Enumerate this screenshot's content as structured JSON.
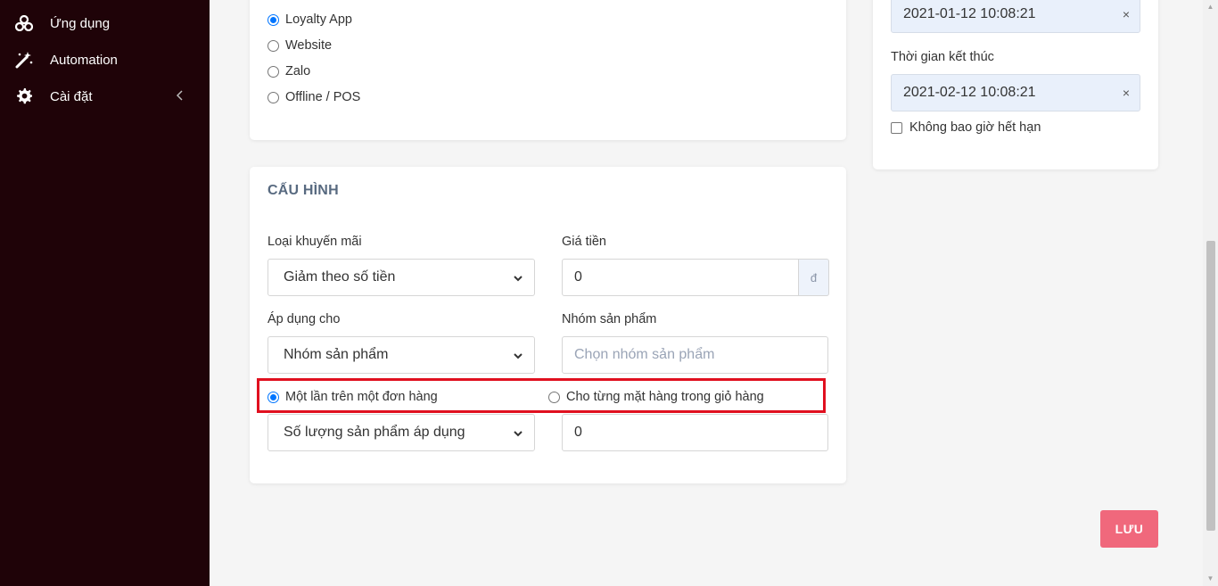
{
  "sidebar": {
    "items": [
      {
        "label": "Ứng dụng",
        "icon": "apps-icon"
      },
      {
        "label": "Automation",
        "icon": "magic-wand-icon"
      },
      {
        "label": "Cài đặt",
        "icon": "gear-icon"
      }
    ]
  },
  "channels": {
    "options": [
      {
        "label": "Loyalty App",
        "checked": true
      },
      {
        "label": "Website",
        "checked": false
      },
      {
        "label": "Zalo",
        "checked": false
      },
      {
        "label": "Offline / POS",
        "checked": false
      }
    ]
  },
  "config": {
    "title": "CẤU HÌNH",
    "promo_type_label": "Loại khuyến mãi",
    "promo_type_value": "Giảm theo số tiền",
    "price_label": "Giá tiền",
    "price_value": "0",
    "currency": "đ",
    "apply_for_label": "Áp dụng cho",
    "apply_for_value": "Nhóm sản phẩm",
    "product_group_label": "Nhóm sản phẩm",
    "product_group_placeholder": "Chọn nhóm sản phẩm",
    "scope_options": [
      {
        "label": "Một lần trên một đơn hàng",
        "checked": true
      },
      {
        "label": "Cho từng mặt hàng trong giỏ hàng",
        "checked": false
      }
    ],
    "quantity_select_value": "Số lượng sản phẩm áp dụng",
    "quantity_value": "0"
  },
  "time": {
    "start_value": "2021-01-12 10:08:21",
    "end_label": "Thời gian kết thúc",
    "end_value": "2021-02-12 10:08:21",
    "clear_glyph": "×",
    "never_expire_label": "Không bao giờ hết hạn"
  },
  "actions": {
    "save_label": "LƯU"
  },
  "colors": {
    "sidebar_bg": "#1f0308",
    "accent": "#0075ff",
    "save_button": "#f0687c",
    "highlight": "#e0101f"
  }
}
